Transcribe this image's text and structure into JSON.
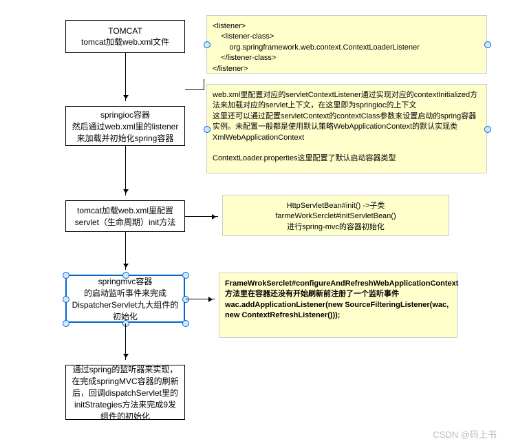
{
  "nodes": {
    "n1": "TOMCAT\ntomcat加载web.xml文件",
    "n2": "springioc容器\n然后通过web.xml里的listener来加载并初始化spring容器",
    "n3": "tomcat加载web.xml里配置servlet（生命周期）init方法",
    "n4": "springmvc容器\n的启动监听事件来完成DispatcherServlet九大组件的初始化",
    "n5": "通过spring的监听器来实现，在完成springMVC容器的刷新后，回调dispatchServlet里的initStrategies方法来完成9发组件的初始化"
  },
  "notes": {
    "a1": "<listener>\n    <listener-class>\n        org.springframework.web.context.ContextLoaderListener\n    </listener-class>\n</listener>",
    "a2": "web.xml里配置对应的servletContextListener通过实现对应的contextInitialized方法来加载对应的servlet上下文，在这里即为springioc的上下文\n这里还可以通过配置servletContext的contextClass参数来设置启动的spring容器实例。未配置一般都是使用默认策略WebApplicationContext的默认实现类XmlWebApplicationContext\n\nContextLoader.properties这里配置了默认启动容器类型",
    "a3": "HttpServletBean#init()   ->子类\nfarmeWorkSerclet#initServletBean()\n进行spring-mvc的容器初始化",
    "a4_bold": "FrameWrokSerclet#configureAndRefreshWebApplicationContext方法里在容器还没有开始刷新前注册了一个监听事件\nwac.addApplicationListener(new SourceFilteringListener(wac, new ContextRefreshListener()));"
  },
  "watermark": "CSDN @码上书"
}
